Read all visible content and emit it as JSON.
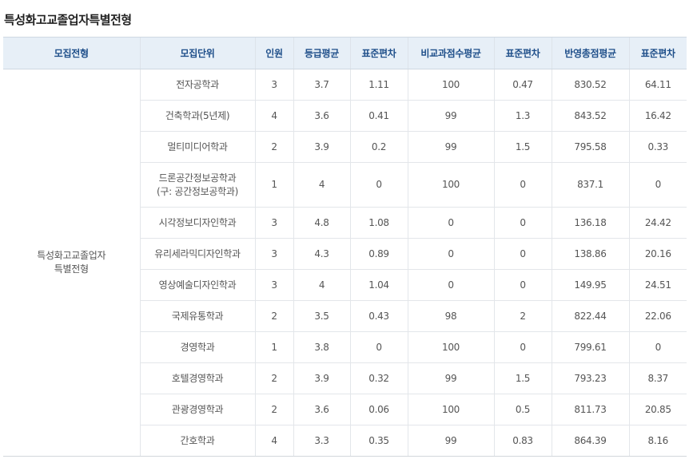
{
  "title": "특성화고교졸업자특별전형",
  "columns": [
    "모집전형",
    "모집단위",
    "인원",
    "등급평균",
    "표준편차",
    "비교과점수평균",
    "표준편차",
    "반영총점평균",
    "표준편차"
  ],
  "group_label_line1": "특성화고교졸업자",
  "group_label_line2": "특별전형",
  "rows": [
    {
      "unit": "전자공학과",
      "count": "3",
      "grade_avg": "3.7",
      "grade_sd": "1.11",
      "extra_avg": "100",
      "extra_sd": "0.47",
      "total_avg": "830.52",
      "total_sd": "64.11"
    },
    {
      "unit": "건축학과(5년제)",
      "count": "4",
      "grade_avg": "3.6",
      "grade_sd": "0.41",
      "extra_avg": "99",
      "extra_sd": "1.3",
      "total_avg": "843.52",
      "total_sd": "16.42"
    },
    {
      "unit": "멀티미디어학과",
      "count": "2",
      "grade_avg": "3.9",
      "grade_sd": "0.2",
      "extra_avg": "99",
      "extra_sd": "1.5",
      "total_avg": "795.58",
      "total_sd": "0.33"
    },
    {
      "unit": "드론공간정보공학과",
      "unit_note": "(구: 공간정보공학과)",
      "count": "1",
      "grade_avg": "4",
      "grade_sd": "0",
      "extra_avg": "100",
      "extra_sd": "0",
      "total_avg": "837.1",
      "total_sd": "0"
    },
    {
      "unit": "시각정보디자인학과",
      "count": "3",
      "grade_avg": "4.8",
      "grade_sd": "1.08",
      "extra_avg": "0",
      "extra_sd": "0",
      "total_avg": "136.18",
      "total_sd": "24.42"
    },
    {
      "unit": "유리세라믹디자인학과",
      "count": "3",
      "grade_avg": "4.3",
      "grade_sd": "0.89",
      "extra_avg": "0",
      "extra_sd": "0",
      "total_avg": "138.86",
      "total_sd": "20.16"
    },
    {
      "unit": "영상예술디자인학과",
      "count": "3",
      "grade_avg": "4",
      "grade_sd": "1.04",
      "extra_avg": "0",
      "extra_sd": "0",
      "total_avg": "149.95",
      "total_sd": "24.51"
    },
    {
      "unit": "국제유통학과",
      "count": "2",
      "grade_avg": "3.5",
      "grade_sd": "0.43",
      "extra_avg": "98",
      "extra_sd": "2",
      "total_avg": "822.44",
      "total_sd": "22.06"
    },
    {
      "unit": "경영학과",
      "count": "1",
      "grade_avg": "3.8",
      "grade_sd": "0",
      "extra_avg": "100",
      "extra_sd": "0",
      "total_avg": "799.61",
      "total_sd": "0"
    },
    {
      "unit": "호텔경영학과",
      "count": "2",
      "grade_avg": "3.9",
      "grade_sd": "0.32",
      "extra_avg": "99",
      "extra_sd": "1.5",
      "total_avg": "793.23",
      "total_sd": "8.37"
    },
    {
      "unit": "관광경영학과",
      "count": "2",
      "grade_avg": "3.6",
      "grade_sd": "0.06",
      "extra_avg": "100",
      "extra_sd": "0.5",
      "total_avg": "811.73",
      "total_sd": "20.85"
    },
    {
      "unit": "간호학과",
      "count": "4",
      "grade_avg": "3.3",
      "grade_sd": "0.35",
      "extra_avg": "99",
      "extra_sd": "0.83",
      "total_avg": "864.39",
      "total_sd": "8.16"
    }
  ]
}
